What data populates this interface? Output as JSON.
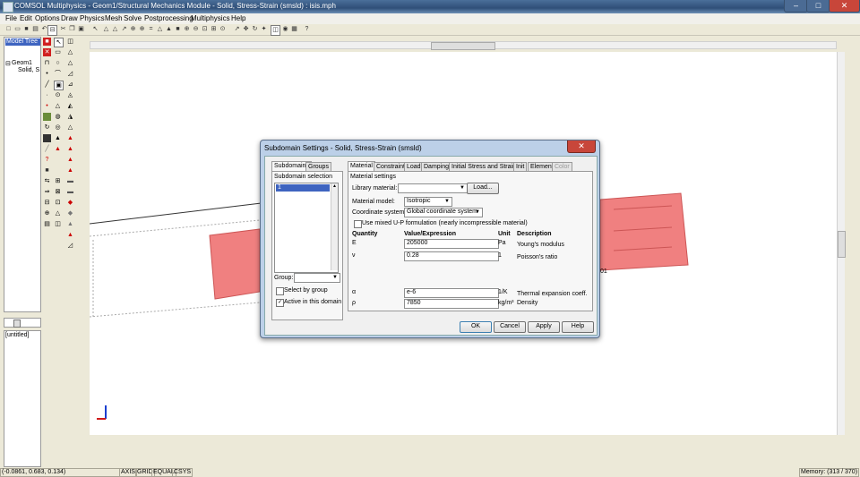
{
  "window": {
    "title": "COMSOL Multiphysics - Geom1/Structural Mechanics Module - Solid, Stress-Strain (smsld) : isis.mph",
    "minimize": "–",
    "maximize": "□",
    "close": "✕"
  },
  "menu": [
    "File",
    "Edit",
    "Options",
    "Draw",
    "Physics",
    "Mesh",
    "Solve",
    "Postprocessing",
    "Multiphysics",
    "Help"
  ],
  "model_tree": {
    "tab": "Model Tree",
    "node1": "Geom1",
    "node2": "Solid, S"
  },
  "untitled_panel": "[untitled]",
  "status": {
    "coords": "(-0.0861, 0.683, 0.134)",
    "axis": "AXIS",
    "grid": "GRID",
    "equal": "EQUAL",
    "csys": "CSYS",
    "memory": "Memory: (313 / 370)"
  },
  "canvas_label": "01",
  "colors": {
    "selection": "#f08080",
    "titlebar": "#2f4f78",
    "dialog_frame": "#bcd0e8"
  },
  "dialog": {
    "title": "Subdomain Settings - Solid, Stress-Strain (smsld)",
    "close": "✕",
    "left_tabs": [
      "Subdomains",
      "Groups"
    ],
    "subdomain_selection_label": "Subdomain selection",
    "subdomain_items": [
      "1"
    ],
    "group_label": "Group:",
    "select_by_group": "Select by group",
    "active_in_domain": "Active in this domain",
    "tabs": [
      "Material",
      "Constraint",
      "Load",
      "Damping",
      "Initial Stress and Strain",
      "Init",
      "Element",
      "Color"
    ],
    "material_settings": "Material settings",
    "library_material_label": "Library material:",
    "library_material_value": "",
    "load_button": "Load...",
    "material_model_label": "Material model:",
    "material_model_value": "Isotropic",
    "coordinate_system_label": "Coordinate system:",
    "coordinate_system_value": "Global coordinate system",
    "mixed_up": "Use mixed U-P formulation (nearly incompressible material)",
    "headers": {
      "quantity": "Quantity",
      "value": "Value/Expression",
      "unit": "Unit",
      "description": "Description"
    },
    "rows": [
      {
        "quantity": "E",
        "value": "205000",
        "unit": "Pa",
        "description": "Young's modulus"
      },
      {
        "quantity": "ν",
        "value": "0.28",
        "unit": "1",
        "description": "Poisson's ratio"
      },
      {
        "quantity": "α",
        "value": "e-6",
        "unit": "1/K",
        "description": "Thermal expansion coeff."
      },
      {
        "quantity": "ρ",
        "value": "7850",
        "unit": "kg/m³",
        "description": "Density"
      }
    ],
    "buttons": {
      "ok": "OK",
      "cancel": "Cancel",
      "apply": "Apply",
      "help": "Help"
    }
  }
}
